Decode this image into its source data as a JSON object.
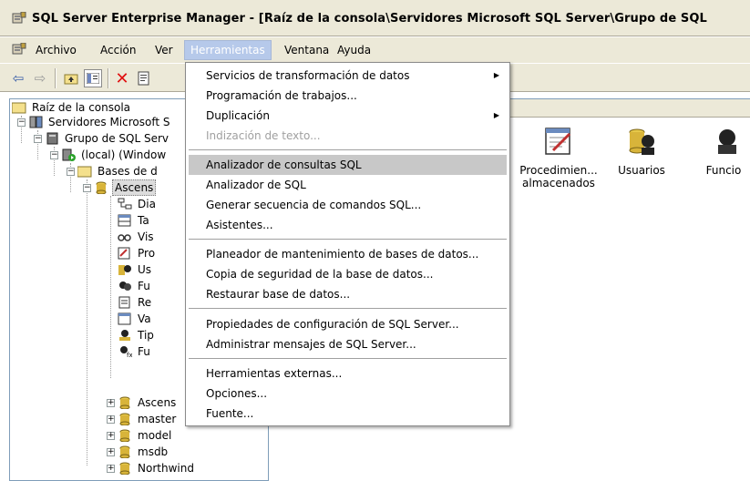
{
  "window": {
    "title": "SQL Server Enterprise Manager - [Raíz de la consola\\Servidores Microsoft SQL Server\\Grupo de SQL"
  },
  "menubar": {
    "items": [
      "Archivo",
      "Acción",
      "Ver",
      "Herramientas",
      "Ventana",
      "Ayuda"
    ],
    "active": "Herramientas"
  },
  "toolbar": {
    "icons": [
      "back-arrow-icon",
      "forward-arrow-icon",
      "up-folder-icon",
      "show-tree-icon",
      "delete-icon",
      "properties-icon"
    ]
  },
  "tree": {
    "root": "Raíz de la consola",
    "servers": "Servidores Microsoft S",
    "group": "Grupo de SQL Serv",
    "local": "(local) (Window",
    "databases": "Bases de d",
    "selected_db": "Ascens",
    "db_children": [
      "Dia",
      "Ta",
      "Vis",
      "Pro",
      "Us",
      "Fu",
      "Re",
      "Va",
      "Tip",
      "Fu"
    ],
    "other_dbs": [
      "Ascens",
      "master",
      "model",
      "msdb",
      "Northwind"
    ]
  },
  "right_pane": {
    "items": [
      {
        "label": "Procedimien...\nalmacenados",
        "line1": "Procedimien...",
        "line2": "almacenados",
        "icon": "stored-procedure-icon"
      },
      {
        "label": "Usuarios",
        "line1": "Usuarios",
        "line2": "",
        "icon": "users-icon"
      },
      {
        "label": "Funcio",
        "line1": "Funcio",
        "line2": "",
        "icon": "roles-icon"
      }
    ]
  },
  "dropdown": {
    "groups": [
      [
        {
          "label": "Servicios de transformación de datos",
          "submenu": true,
          "disabled": false
        },
        {
          "label": "Programación de trabajos...",
          "submenu": false,
          "disabled": false
        },
        {
          "label": "Duplicación",
          "submenu": true,
          "disabled": false
        },
        {
          "label": "Indización de texto...",
          "submenu": false,
          "disabled": true
        }
      ],
      [
        {
          "label": "Analizador de consultas SQL",
          "submenu": false,
          "disabled": false,
          "highlighted": true
        },
        {
          "label": "Analizador de SQL",
          "submenu": false,
          "disabled": false
        },
        {
          "label": "Generar secuencia de comandos SQL...",
          "submenu": false,
          "disabled": false
        },
        {
          "label": "Asistentes...",
          "submenu": false,
          "disabled": false
        }
      ],
      [
        {
          "label": "Planeador de mantenimiento de bases de datos...",
          "submenu": false,
          "disabled": false
        },
        {
          "label": "Copia de seguridad de la base de datos...",
          "submenu": false,
          "disabled": false
        },
        {
          "label": "Restaurar base de datos...",
          "submenu": false,
          "disabled": false
        }
      ],
      [
        {
          "label": "Propiedades de configuración de SQL Server...",
          "submenu": false,
          "disabled": false
        },
        {
          "label": "Administrar mensajes de SQL Server...",
          "submenu": false,
          "disabled": false
        }
      ],
      [
        {
          "label": "Herramientas externas...",
          "submenu": false,
          "disabled": false
        },
        {
          "label": "Opciones...",
          "submenu": false,
          "disabled": false
        },
        {
          "label": "Fuente...",
          "submenu": false,
          "disabled": false
        }
      ]
    ]
  },
  "colors": {
    "chrome": "#ece9d8",
    "menu_highlight": "#c8c8c8",
    "active_menu": "#b6c9ea"
  }
}
